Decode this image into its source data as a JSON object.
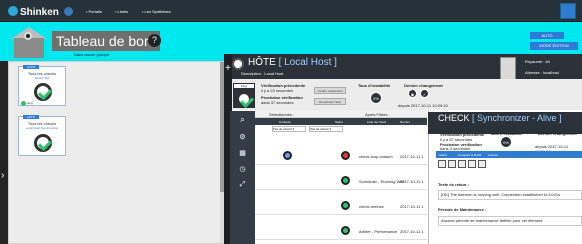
{
  "nav": {
    "logo": "Shinken",
    "menu": [
      "• Portails",
      "• Listes",
      "• Les Synthèses"
    ]
  },
  "dashboard": {
    "title": "Tableau de bord",
    "subtitle": "Dans aucun groupe",
    "auto": "AUTO",
    "mode": "MODE ÉDITION"
  },
  "cards": [
    {
      "auto": "AUTO",
      "title": "Tous les checks",
      "sub": "Cluster Dot",
      "mini": "ping"
    },
    {
      "auto": "AUTO",
      "title": "Tous les checks",
      "sub": "Local Host Synchronizer"
    }
  ],
  "host": {
    "label": "HÔTE",
    "name": "[ Local Host ]",
    "desc": "Description : Local Host",
    "realm_k": "Royaume : All",
    "addr_k": "Adresse : localhost",
    "status": "Ping",
    "prev_label": "Vérification précédente",
    "prev_val": "il y a 23 secondes",
    "next_label": "Prochaine vérification",
    "next_val": "dans 37 secondes",
    "btn1": "Vérifier maintenant",
    "btn2": "Recalculez l'état",
    "inst_label": "Taux d'instabilité",
    "inst": "0%",
    "chg_label": "Dernier changement",
    "chg_val": "depuis 2017-10-11 10:09:10"
  },
  "table": {
    "selected": "Sélectionnés :",
    "filter": "Après Filtres :",
    "cols": [
      "Contexte",
      "Statut",
      "Liste de check",
      "Dernier"
    ],
    "filter_ph": "Pas de sélecti ▾",
    "rows": [
      {
        "name": "check-loop-custom",
        "date": "2017-10-11 1"
      },
      {
        "name": "Scheduler - Running Well",
        "date": "2017-10-11 1"
      },
      {
        "name": "check-metrics",
        "date": "2017-10-11 1"
      },
      {
        "name": "Arbiter - Performance",
        "date": "2017-10-11 1"
      }
    ]
  },
  "check": {
    "label": "CHECK",
    "name": "[ Synchronizer - Alive ]",
    "status": "Ping",
    "prev_label": "Vérification précédente",
    "prev_val": "il y a 57 secondes",
    "next_label": "Prochaine vérification",
    "next_val": "dans 3 secondes",
    "inst_label": "Taux d'instabilité",
    "inst": "0%",
    "chg_label": "Dernier changement",
    "chg_val": "depuis 2017-10-11 10:09:10",
    "tabs": [
      "Sabré",
      "Compare & RadT",
      "Avancé"
    ],
    "out_title": "Texte de retour :",
    "out": "[OK] The daemon is running well. Connection established in 0.001s",
    "maint_title": "Période de Maintenance :",
    "maint": "Aucune période de maintenance définie pour cet élément"
  }
}
